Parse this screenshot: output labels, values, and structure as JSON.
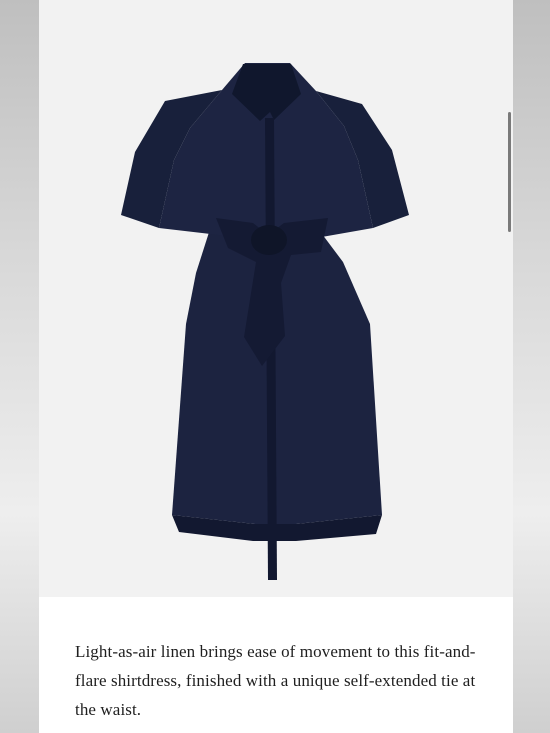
{
  "product": {
    "image_alt": "Navy shirtdress with tie waist",
    "description": "Light-as-air linen brings ease of movement to this fit-and-flare shirtdress, finished with a unique self-extended tie at the waist."
  },
  "colors": {
    "dress": "#1c2340",
    "dress_shadow": "#121830",
    "photo_background": "#f2f2f2"
  },
  "icons": {
    "scrollbar": "scroll-thumb"
  }
}
